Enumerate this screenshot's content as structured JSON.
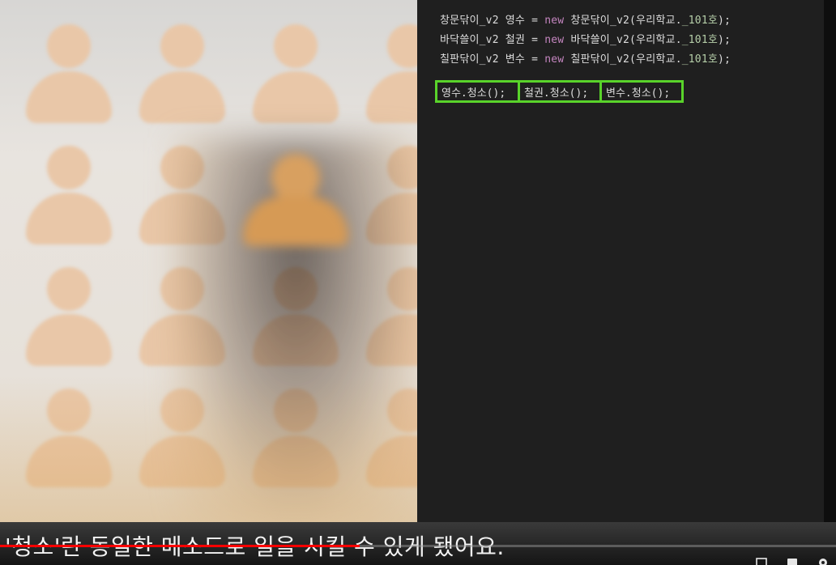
{
  "code": {
    "line1": {
      "type": "창문닦이_v2",
      "var": "영수",
      "op": "=",
      "kw": "new",
      "ctor": "창문닦이_v2(우리학교.",
      "num": "_101호",
      "end": ");"
    },
    "line2": {
      "type": "바닥쓸이_v2",
      "var": "철권",
      "op": "=",
      "kw": "new",
      "ctor": "바닥쓸이_v2(우리학교.",
      "num": "_101호",
      "end": ");"
    },
    "line3": {
      "type": "칠판닦이_v2",
      "var": "변수",
      "op": "=",
      "kw": "new",
      "ctor": "칠판닦이_v2(우리학교.",
      "num": "_101호",
      "end": ");"
    },
    "calls": [
      "영수.청소();",
      "철권.청소();",
      "변수.청소();"
    ]
  },
  "subtitle": "'청소'란 동일한 메소드로 일을 시킬 수 있게 됐어요.",
  "player": {
    "progress": 0.43
  },
  "icons": [
    "settings-icon",
    "captions-icon",
    "miniplayer-icon"
  ],
  "colors": {
    "highlight": "#59d32a",
    "keyword": "#c586c0",
    "progress": "#ff0000"
  }
}
